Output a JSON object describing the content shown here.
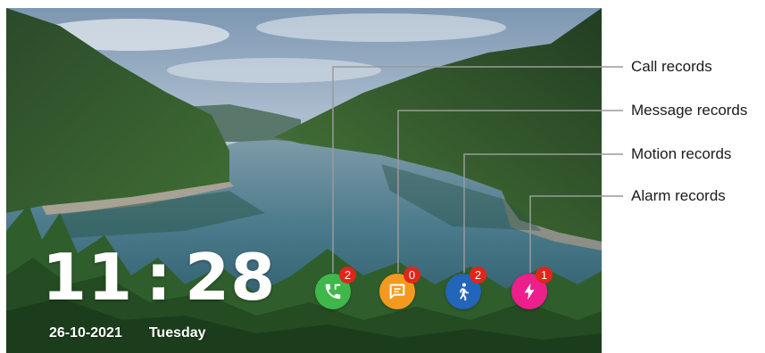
{
  "clock": {
    "hour": "11",
    "separator": ":",
    "minute": "28"
  },
  "date": {
    "date": "26-10-2021",
    "weekday": "Tuesday"
  },
  "records": [
    {
      "id": "call",
      "label": "Call records",
      "count": "2",
      "color": "#3fb74a",
      "icon": "phone-icon"
    },
    {
      "id": "message",
      "label": "Message records",
      "count": "0",
      "color": "#f39a1e",
      "icon": "message-icon"
    },
    {
      "id": "motion",
      "label": "Motion records",
      "count": "2",
      "color": "#2365b8",
      "icon": "walking-person-icon"
    },
    {
      "id": "alarm",
      "label": "Alarm records",
      "count": "1",
      "color": "#ec1f8c",
      "icon": "lightning-icon"
    }
  ],
  "colors": {
    "leader_line": "#9a9a9a",
    "badge": "#e0251b",
    "text": "#1a1a1a"
  }
}
